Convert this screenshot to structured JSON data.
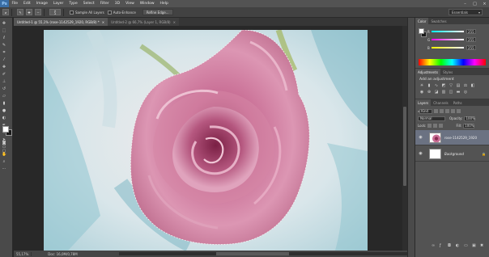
{
  "app": {
    "logo": "Ps"
  },
  "menu": [
    "File",
    "Edit",
    "Image",
    "Layer",
    "Type",
    "Select",
    "Filter",
    "3D",
    "View",
    "Window",
    "Help"
  ],
  "window_controls": {
    "minimize": "–",
    "maximize": "□",
    "close": "×"
  },
  "options": {
    "sample_all_layers": "Sample All Layers",
    "auto_enhance": "Auto-Enhance",
    "refine_edge": "Refine Edge...",
    "brush_size": "5",
    "workspace": "Essentials"
  },
  "tabs": [
    {
      "label": "Untitled-1 @ 55,1% (rose-1142529_1920, RGB/8) *",
      "close": "×"
    },
    {
      "label": "Untitled-2 @ 66,7% (Layer 1, RGB/8)",
      "close": "×"
    }
  ],
  "status": {
    "zoom": "55,17%",
    "doc": "Doc: 16,0M/0,78M"
  },
  "color_panel": {
    "tabs": [
      "Color",
      "Swatches"
    ],
    "sliders": [
      {
        "label": "R",
        "value": "255"
      },
      {
        "label": "G",
        "value": "255"
      },
      {
        "label": "B",
        "value": "255"
      }
    ]
  },
  "adjustments": {
    "tabs": [
      "Adjustments",
      "Styles"
    ],
    "title": "Add an adjustment"
  },
  "layers_panel": {
    "tabs": [
      "Layers",
      "Channels",
      "Paths"
    ],
    "kind": "Kind",
    "blend_mode": "Normal",
    "opacity_label": "Opacity:",
    "opacity": "100%",
    "lock_label": "Lock:",
    "fill_label": "Fill:",
    "fill": "100%",
    "layers": [
      {
        "name": "rose-1142529_1920",
        "selected": true
      },
      {
        "name": "Background",
        "selected": false
      }
    ]
  },
  "colors": {
    "accent": "#6b7282",
    "background": "#282828"
  }
}
